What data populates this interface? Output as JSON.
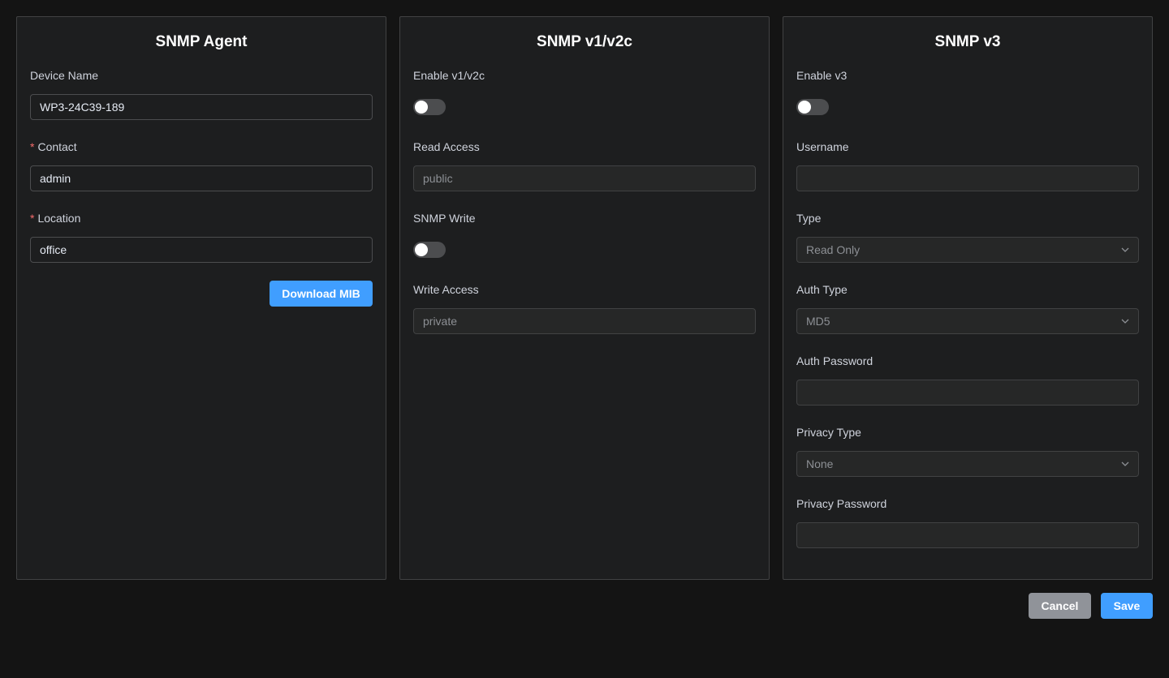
{
  "agent": {
    "title": "SNMP Agent",
    "device_name_label": "Device Name",
    "device_name_value": "WP3-24C39-189",
    "contact_label": "Contact",
    "contact_value": "admin",
    "location_label": "Location",
    "location_value": "office",
    "required_mark": "*",
    "download_mib_label": "Download MIB"
  },
  "v1v2c": {
    "title": "SNMP v1/v2c",
    "enable_label": "Enable v1/v2c",
    "enable_on": false,
    "read_access_label": "Read Access",
    "read_access_value": "public",
    "snmp_write_label": "SNMP Write",
    "snmp_write_on": false,
    "write_access_label": "Write Access",
    "write_access_value": "private"
  },
  "v3": {
    "title": "SNMP v3",
    "enable_label": "Enable v3",
    "enable_on": false,
    "username_label": "Username",
    "username_value": "",
    "type_label": "Type",
    "type_value": "Read Only",
    "auth_type_label": "Auth Type",
    "auth_type_value": "MD5",
    "auth_password_label": "Auth Password",
    "auth_password_value": "",
    "privacy_type_label": "Privacy Type",
    "privacy_type_value": "None",
    "privacy_password_label": "Privacy Password",
    "privacy_password_value": ""
  },
  "footer": {
    "cancel_label": "Cancel",
    "save_label": "Save"
  },
  "icons": {
    "dropdown": "chevron-down-icon"
  },
  "colors": {
    "primary": "#409eff",
    "cancel": "#909399",
    "required": "#f56c6c"
  }
}
